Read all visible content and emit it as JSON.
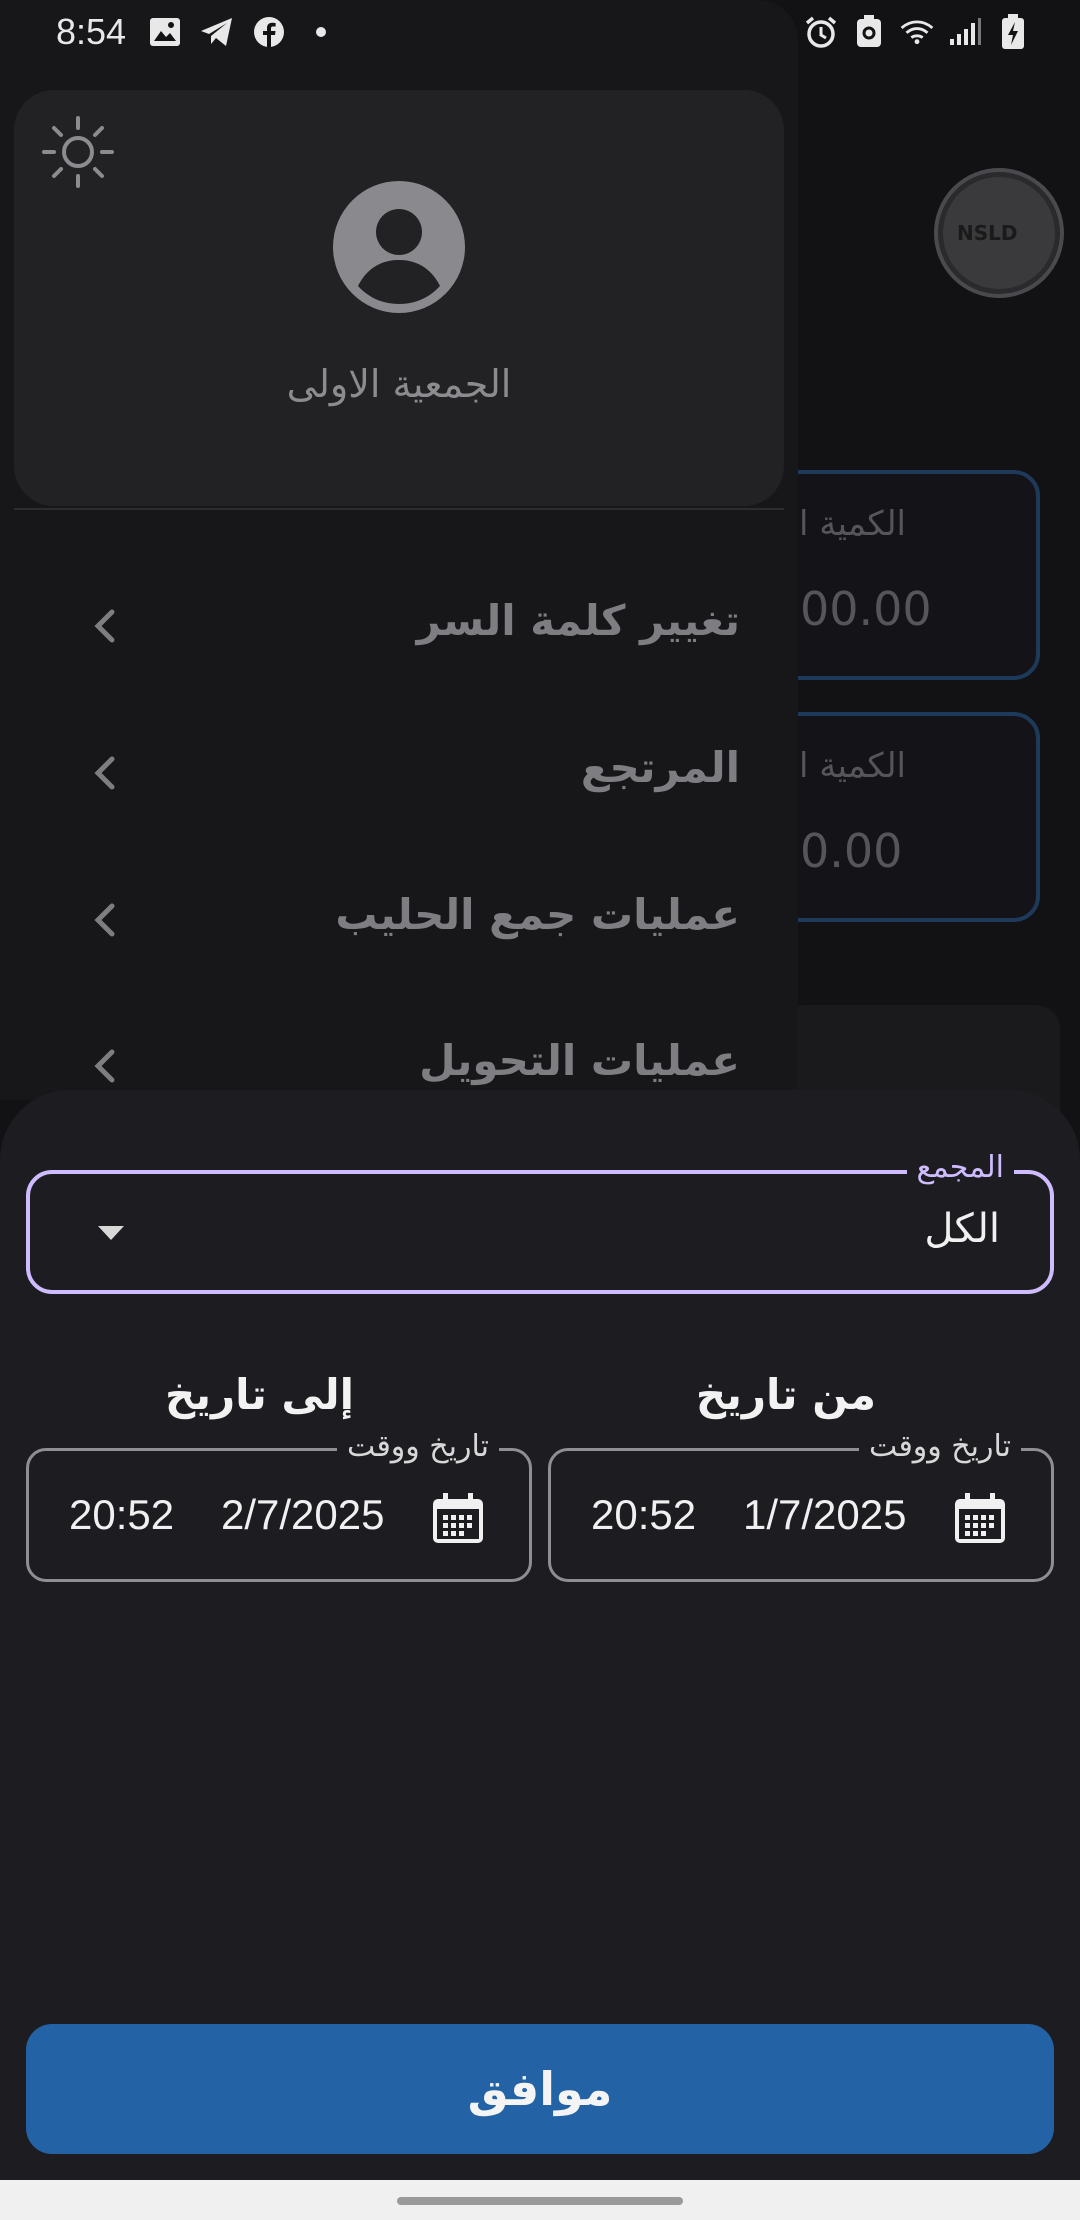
{
  "status_bar": {
    "time": "8:54"
  },
  "background": {
    "logo_text": "NSLD",
    "card1": {
      "title": "الكمية ال",
      "value": "00.00"
    },
    "card2": {
      "title": "الكمية ا",
      "value": "0.00"
    }
  },
  "drawer": {
    "org_name": "الجمعية الاولى",
    "items": [
      {
        "label": "تغيير كلمة السر"
      },
      {
        "label": "المرتجع"
      },
      {
        "label": "عمليات جمع الحليب"
      },
      {
        "label": "عمليات التحويل"
      }
    ]
  },
  "sheet": {
    "collector": {
      "label": "المجمع",
      "value": "الكل"
    },
    "from": {
      "title": "من تاريخ",
      "field_label": "تاريخ ووقت",
      "date": "1/7/2025",
      "time": "20:52"
    },
    "to": {
      "title": "إلى تاريخ",
      "field_label": "تاريخ ووقت",
      "date": "2/7/2025",
      "time": "20:52"
    },
    "ok_label": "موافق"
  },
  "colors": {
    "accent": "#cfbcff",
    "button": "#2462a6",
    "sheet_bg": "#1d1c21"
  }
}
